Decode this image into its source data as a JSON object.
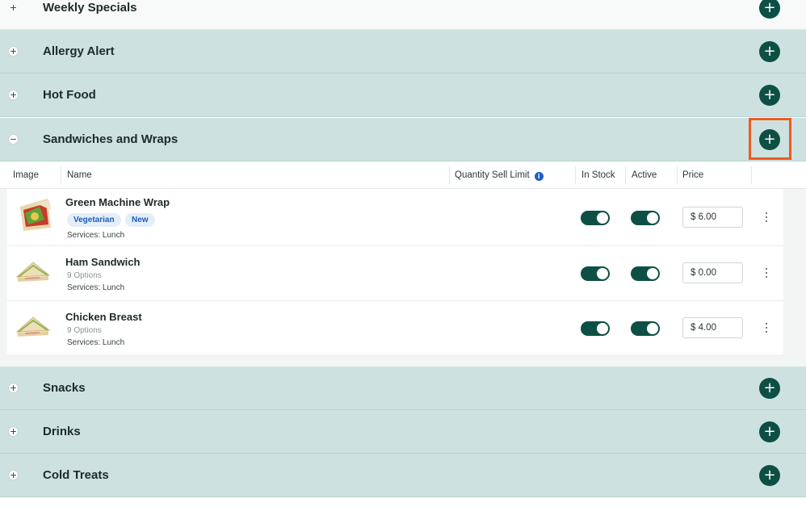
{
  "sections": [
    {
      "title": "Weekly Specials",
      "toggle": "+"
    },
    {
      "title": "Allergy Alert",
      "toggle": "+"
    },
    {
      "title": "Hot Food",
      "toggle": "+"
    },
    {
      "title": "Sandwiches and Wraps",
      "toggle": "−"
    },
    {
      "title": "Snacks",
      "toggle": "+"
    },
    {
      "title": "Drinks",
      "toggle": "+"
    },
    {
      "title": "Cold Treats",
      "toggle": "+"
    }
  ],
  "add_symbol": "+",
  "table": {
    "headers": {
      "image": "Image",
      "name": "Name",
      "quantity_limit": "Quantity Sell Limit",
      "in_stock": "In Stock",
      "active": "Active",
      "price": "Price"
    },
    "info_symbol": "i",
    "rows": [
      {
        "name": "Green Machine Wrap",
        "tags": [
          "Vegetarian",
          "New"
        ],
        "options": "",
        "services": "Services: Lunch",
        "in_stock": true,
        "active": true,
        "price": "$ 6.00"
      },
      {
        "name": "Ham Sandwich",
        "tags": [],
        "options": "9 Options",
        "services": "Services: Lunch",
        "in_stock": true,
        "active": true,
        "price": "$ 0.00"
      },
      {
        "name": "Chicken Breast",
        "tags": [],
        "options": "9 Options",
        "services": "Services: Lunch",
        "in_stock": true,
        "active": true,
        "price": "$ 4.00"
      }
    ]
  },
  "colors": {
    "accent": "#0e4f45",
    "section_bg": "#cde2e0",
    "highlight": "#ee5a1f",
    "tag_text": "#1a5db8"
  }
}
